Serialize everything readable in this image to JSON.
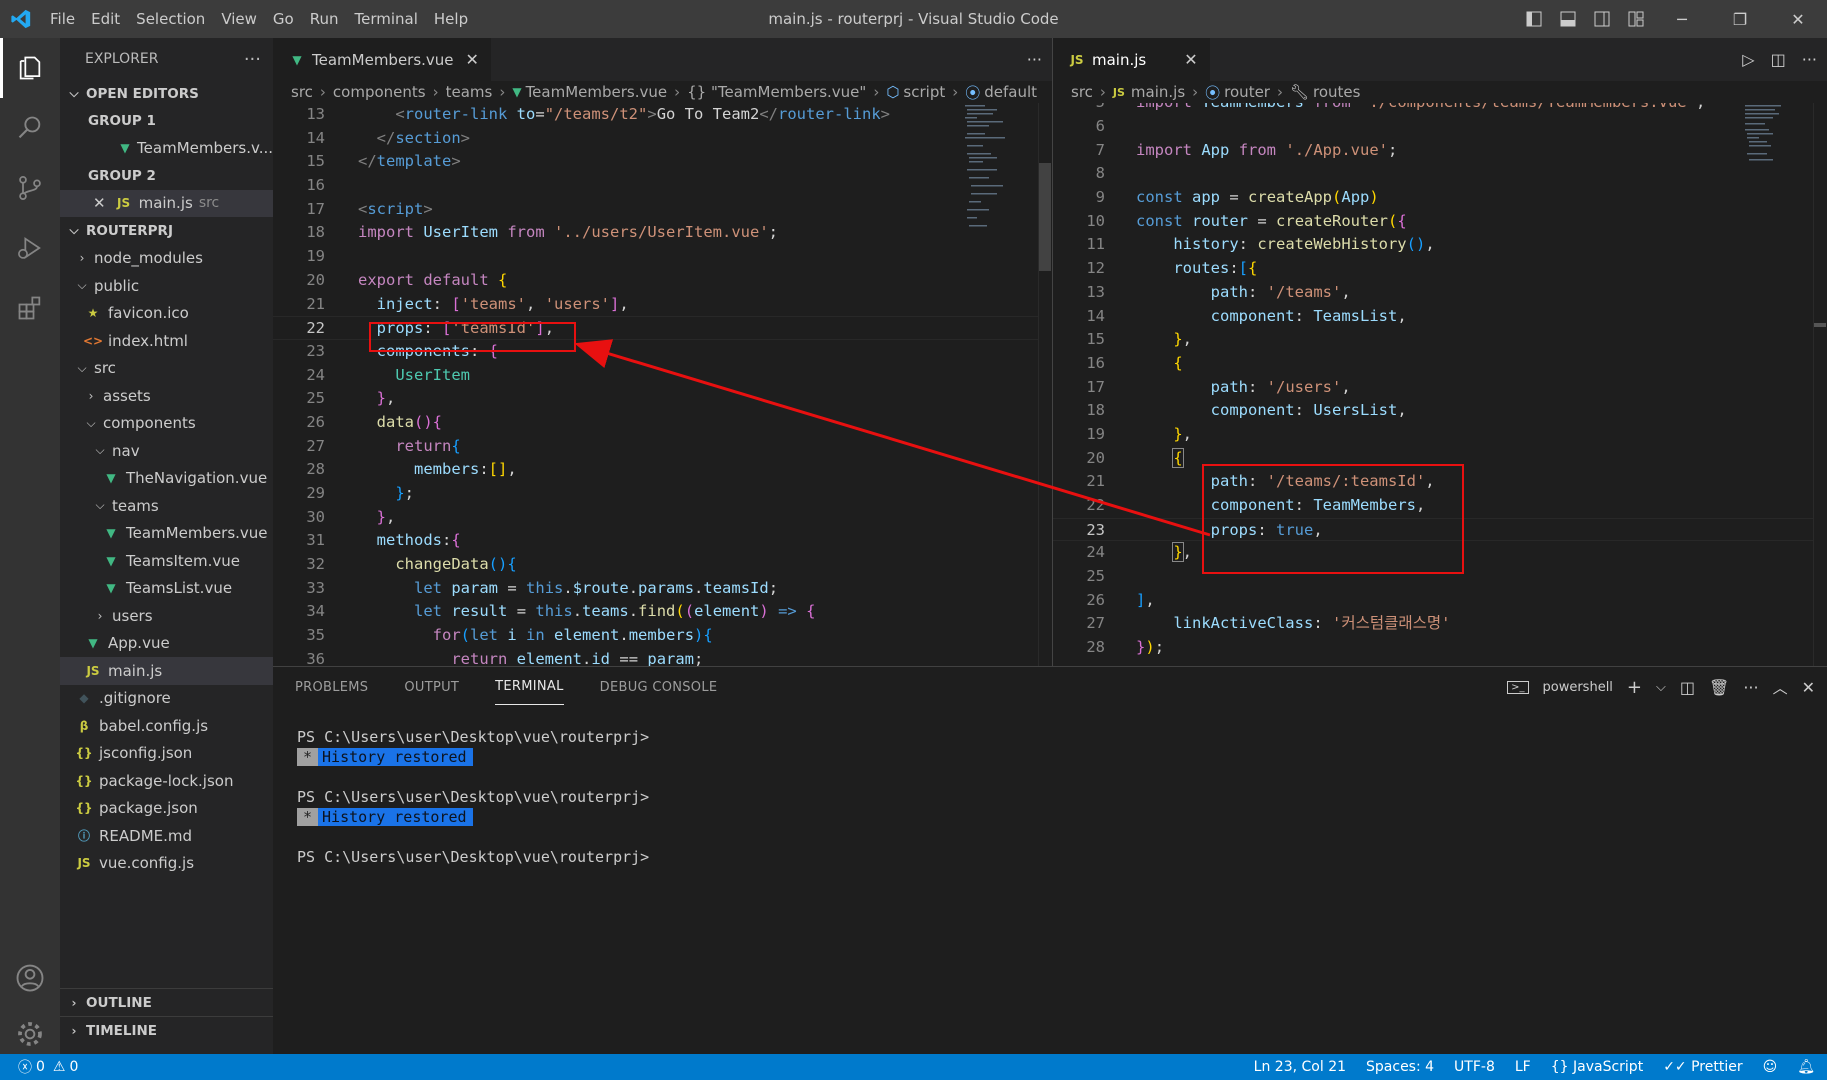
{
  "window": {
    "title": "main.js - routerprj - Visual Studio Code"
  },
  "menu": [
    "File",
    "Edit",
    "Selection",
    "View",
    "Go",
    "Run",
    "Terminal",
    "Help"
  ],
  "explorer": {
    "header": "EXPLORER",
    "open_editors": "OPEN EDITORS",
    "group1": "GROUP 1",
    "group1_file": "TeamMembers.v...",
    "group2": "GROUP 2",
    "group2_file": "main.js",
    "group2_path": "src",
    "project": "ROUTERPRJ",
    "tree": [
      {
        "label": "node_modules",
        "type": "folder"
      },
      {
        "label": "public",
        "type": "folder-open"
      },
      {
        "label": "favicon.ico",
        "type": "star"
      },
      {
        "label": "index.html",
        "type": "html"
      },
      {
        "label": "src",
        "type": "folder-open"
      },
      {
        "label": "assets",
        "type": "folder"
      },
      {
        "label": "components",
        "type": "folder-open"
      },
      {
        "label": "nav",
        "type": "folder-open"
      },
      {
        "label": "TheNavigation.vue",
        "type": "vue"
      },
      {
        "label": "teams",
        "type": "folder-open"
      },
      {
        "label": "TeamMembers.vue",
        "type": "vue"
      },
      {
        "label": "TeamsItem.vue",
        "type": "vue"
      },
      {
        "label": "TeamsList.vue",
        "type": "vue"
      },
      {
        "label": "users",
        "type": "folder"
      },
      {
        "label": "App.vue",
        "type": "vue"
      },
      {
        "label": "main.js",
        "type": "js"
      },
      {
        "label": ".gitignore",
        "type": "git"
      },
      {
        "label": "babel.config.js",
        "type": "babel"
      },
      {
        "label": "jsconfig.json",
        "type": "json"
      },
      {
        "label": "package-lock.json",
        "type": "json"
      },
      {
        "label": "package.json",
        "type": "json"
      },
      {
        "label": "README.md",
        "type": "info"
      },
      {
        "label": "vue.config.js",
        "type": "js"
      }
    ],
    "outline": "OUTLINE",
    "timeline": "TIMELINE"
  },
  "left_editor": {
    "tab": "TeamMembers.vue",
    "breadcrumb": [
      "src",
      "components",
      "teams",
      "TeamMembers.vue",
      "{} \"TeamMembers.vue\"",
      "script",
      "default"
    ]
  },
  "right_editor": {
    "tab": "main.js",
    "breadcrumb": [
      "src",
      "main.js",
      "router",
      "routes"
    ]
  },
  "panel": {
    "tabs": [
      "PROBLEMS",
      "OUTPUT",
      "TERMINAL",
      "DEBUG CONSOLE"
    ],
    "shell": "powershell",
    "prompt": "PS C:\\Users\\user\\Desktop\\vue\\routerprj>",
    "history_star": "*",
    "history": "History restored"
  },
  "status": {
    "errors": "0",
    "warnings": "0",
    "position": "Ln 23, Col 21",
    "spaces": "Spaces: 4",
    "encoding": "UTF-8",
    "eol": "LF",
    "language": "JavaScript",
    "prettier": "Prettier"
  },
  "colors": {
    "accent": "#007acc",
    "annotation": "#e81010"
  }
}
